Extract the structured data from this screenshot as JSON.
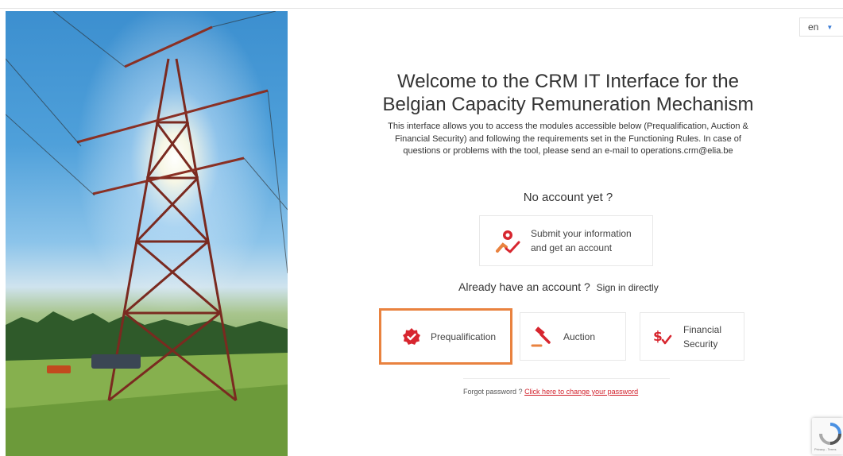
{
  "language": {
    "selected": "en"
  },
  "welcome": {
    "line1": "Welcome to the CRM IT Interface for the",
    "line2": "Belgian Capacity Remuneration Mechanism",
    "intro_line1": "This interface allows you to access the modules accessible below (Prequalification, Auction &",
    "intro_line2": "Financial Security) and following the requirements set in the Functioning Rules. In case of",
    "intro_line3": "questions or problems with the tool, please send an e-mail to operations.crm@elia.be"
  },
  "signup": {
    "heading": "No account yet ?",
    "card_line1": "Submit your information",
    "card_line2": "and get an account",
    "icon": "user-check-icon"
  },
  "signin": {
    "heading": "Already have an account ?",
    "sub": "Sign in directly"
  },
  "modules": [
    {
      "label": "Prequalification",
      "icon": "badge-check-icon"
    },
    {
      "label": "Auction",
      "icon": "gavel-icon"
    },
    {
      "label_line1": "Financial",
      "label_line2": "Security",
      "icon": "money-check-icon"
    }
  ],
  "password": {
    "prefix": "Forgot password ?",
    "link": "Click here to change your password"
  },
  "recaptcha": {
    "text": "Privacy - Terms"
  },
  "colors": {
    "accent": "#e9823f",
    "icon_red": "#d7262f",
    "link": "#d21f2a"
  }
}
